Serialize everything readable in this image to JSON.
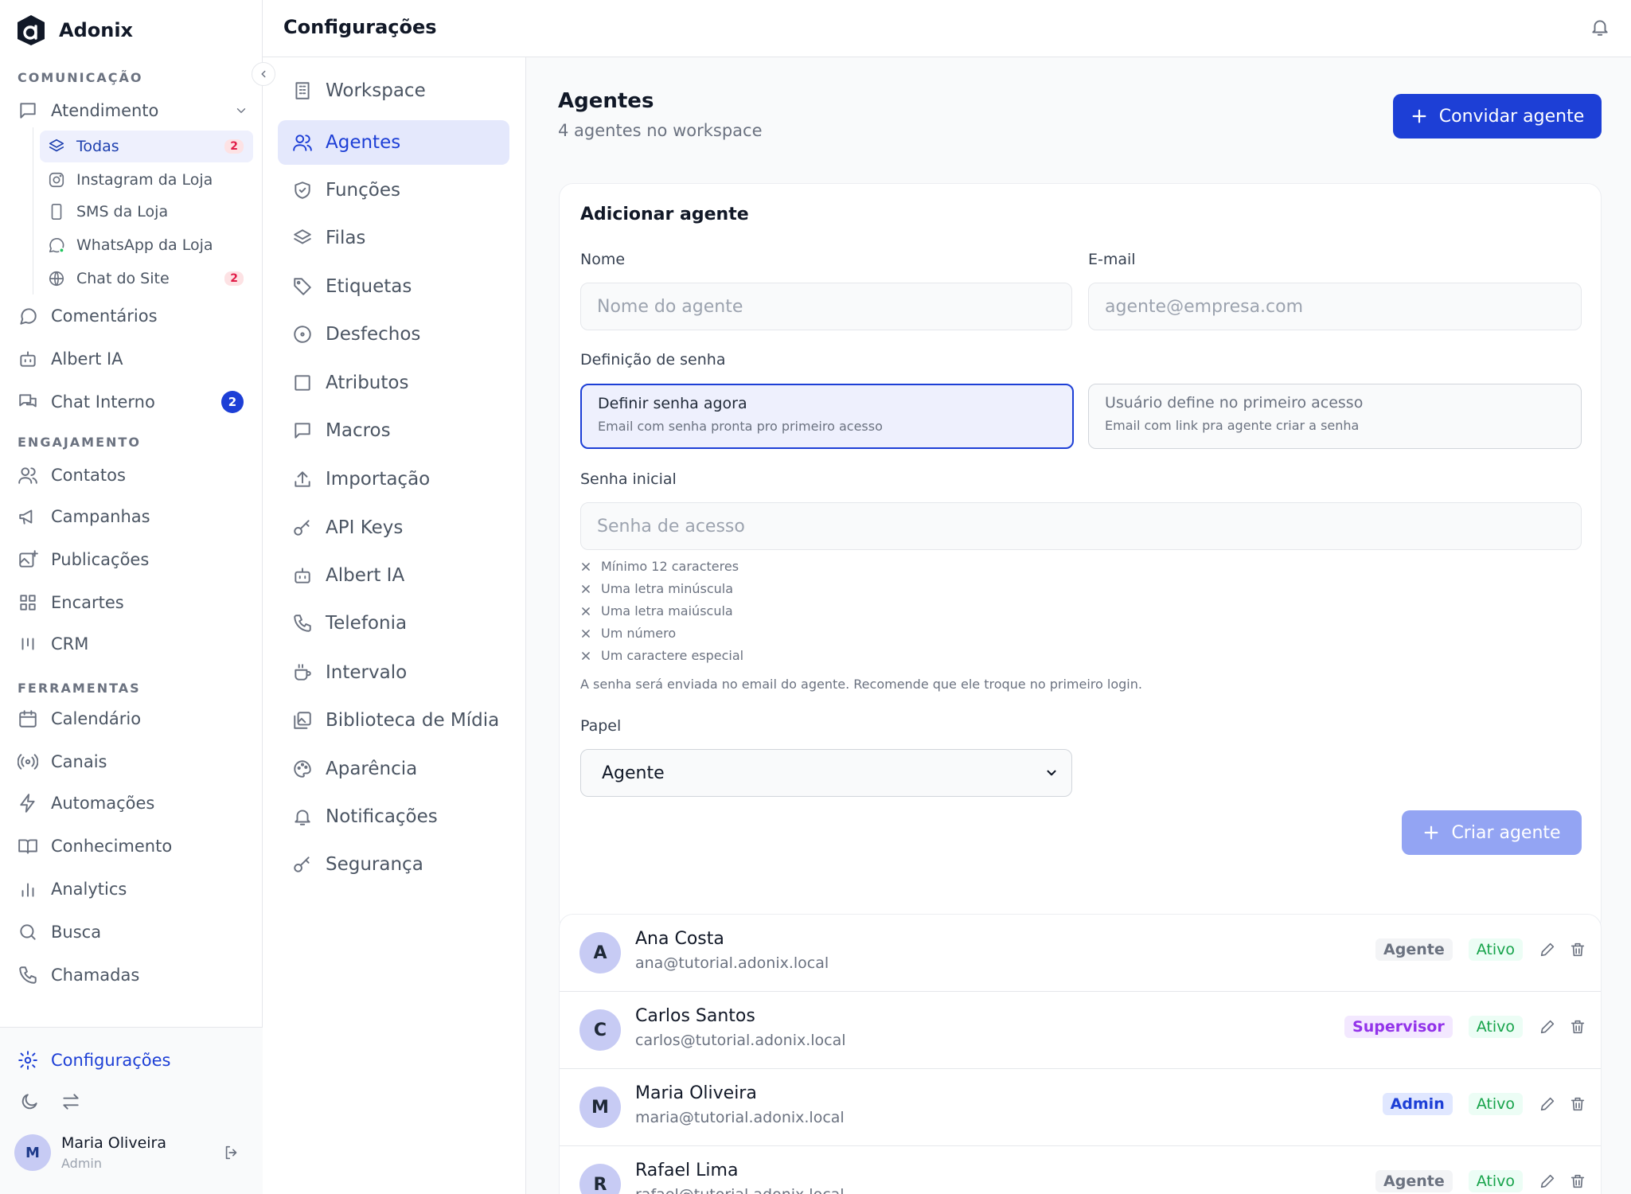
{
  "app": {
    "name": "Adonix"
  },
  "sidebar": {
    "sections": {
      "comunicacao": "COMUNICAÇÃO",
      "engajamento": "ENGAJAMENTO",
      "ferramentas": "FERRAMENTAS"
    },
    "atendimento": {
      "label": "Atendimento",
      "children": [
        {
          "label": "Todas",
          "badge": "2",
          "active": true,
          "icon": "layers-icon"
        },
        {
          "label": "Instagram da Loja",
          "icon": "instagram-icon"
        },
        {
          "label": "SMS da Loja",
          "icon": "phone-device-icon"
        },
        {
          "label": "WhatsApp da Loja",
          "icon": "whatsapp-icon"
        },
        {
          "label": "Chat do Site",
          "badge": "2",
          "icon": "globe-icon"
        }
      ]
    },
    "comunicacao_items": [
      {
        "label": "Comentários",
        "icon": "comment-icon"
      },
      {
        "label": "Albert IA",
        "icon": "bot-icon"
      },
      {
        "label": "Chat Interno",
        "badge": "2",
        "icon": "chat-icon"
      }
    ],
    "engajamento_items": [
      {
        "label": "Contatos",
        "icon": "users-icon"
      },
      {
        "label": "Campanhas",
        "icon": "megaphone-icon"
      },
      {
        "label": "Publicações",
        "icon": "image-plus-icon"
      },
      {
        "label": "Encartes",
        "icon": "grid-icon"
      },
      {
        "label": "CRM",
        "icon": "kanban-icon"
      }
    ],
    "ferramentas_items": [
      {
        "label": "Calendário",
        "icon": "calendar-icon"
      },
      {
        "label": "Canais",
        "icon": "radio-icon"
      },
      {
        "label": "Automações",
        "icon": "zap-icon"
      },
      {
        "label": "Conhecimento",
        "icon": "book-icon"
      },
      {
        "label": "Analytics",
        "icon": "bar-chart-icon"
      },
      {
        "label": "Busca",
        "icon": "search-icon"
      },
      {
        "label": "Chamadas",
        "icon": "phone-icon"
      }
    ],
    "settings_label": "Configurações",
    "user": {
      "initial": "M",
      "name": "Maria Oliveira",
      "role": "Admin"
    }
  },
  "header": {
    "title": "Configurações"
  },
  "settings_menu": [
    {
      "label": "Workspace",
      "icon": "building-icon"
    },
    {
      "label": "Agentes",
      "icon": "users-icon",
      "active": true
    },
    {
      "label": "Funções",
      "icon": "shield-icon"
    },
    {
      "label": "Filas",
      "icon": "layers-icon"
    },
    {
      "label": "Etiquetas",
      "icon": "tag-icon"
    },
    {
      "label": "Desfechos",
      "icon": "target-icon"
    },
    {
      "label": "Atributos",
      "icon": "square-icon"
    },
    {
      "label": "Macros",
      "icon": "message-square-icon"
    },
    {
      "label": "Importação",
      "icon": "upload-icon"
    },
    {
      "label": "API Keys",
      "icon": "key-icon"
    },
    {
      "label": "Albert IA",
      "icon": "bot-icon"
    },
    {
      "label": "Telefonia",
      "icon": "phone-icon"
    },
    {
      "label": "Intervalo",
      "icon": "coffee-icon"
    },
    {
      "label": "Biblioteca de Mídia",
      "icon": "media-library-icon"
    },
    {
      "label": "Aparência",
      "icon": "palette-icon"
    },
    {
      "label": "Notificações",
      "icon": "bell-icon"
    },
    {
      "label": "Segurança",
      "icon": "key-icon"
    }
  ],
  "main": {
    "title": "Agentes",
    "subtitle": "4 agentes no workspace",
    "invite_button": "Convidar agente",
    "form": {
      "title": "Adicionar agente",
      "name_label": "Nome",
      "name_placeholder": "Nome do agente",
      "email_label": "E-mail",
      "email_placeholder": "agente@empresa.com",
      "password_def_label": "Definição de senha",
      "option_now": {
        "title": "Definir senha agora",
        "desc": "Email com senha pronta pro primeiro acesso"
      },
      "option_user": {
        "title": "Usuário define no primeiro acesso",
        "desc": "Email com link pra agente criar a senha"
      },
      "initial_password_label": "Senha inicial",
      "initial_password_placeholder": "Senha de acesso",
      "rules": [
        "Mínimo 12 caracteres",
        "Uma letra minúscula",
        "Uma letra maiúscula",
        "Um número",
        "Um caractere especial"
      ],
      "note": "A senha será enviada no email do agente. Recomende que ele troque no primeiro login.",
      "role_label": "Papel",
      "role_value": "Agente",
      "submit": "Criar agente"
    },
    "agents": [
      {
        "initial": "A",
        "name": "Ana Costa",
        "email": "ana@tutorial.adonix.local",
        "role": "Agente",
        "status": "Ativo"
      },
      {
        "initial": "C",
        "name": "Carlos Santos",
        "email": "carlos@tutorial.adonix.local",
        "role": "Supervisor",
        "status": "Ativo"
      },
      {
        "initial": "M",
        "name": "Maria Oliveira",
        "email": "maria@tutorial.adonix.local",
        "role": "Admin",
        "status": "Ativo"
      },
      {
        "initial": "R",
        "name": "Rafael Lima",
        "email": "rafael@tutorial.adonix.local",
        "role": "Agente",
        "status": "Ativo"
      }
    ]
  },
  "colors": {
    "primary": "#1d3fd6",
    "active_bg": "#e4e8fc",
    "badge_red": "#e11d48",
    "success": "#16a34a",
    "supervisor": "#9333ea"
  }
}
